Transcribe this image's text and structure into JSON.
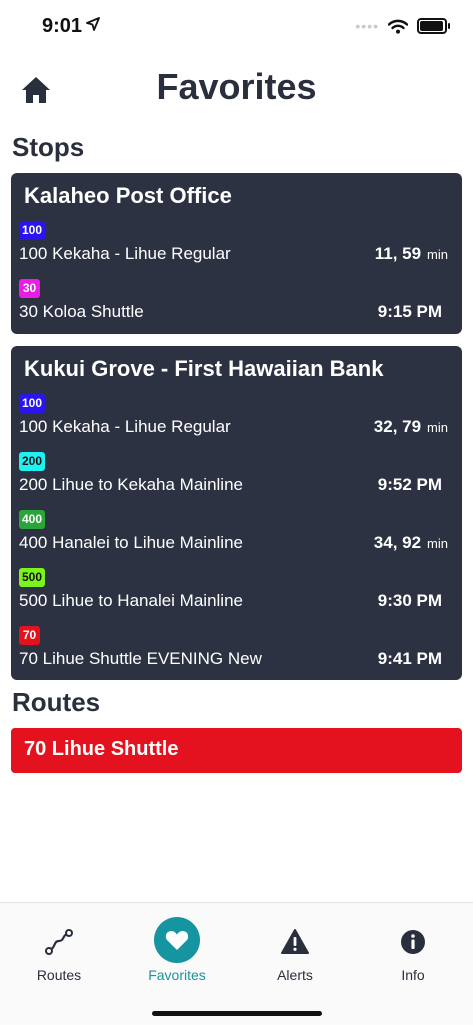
{
  "status_bar": {
    "time": "9:01",
    "icons": [
      "location-arrow-icon",
      "signal-dots-icon",
      "wifi-icon",
      "battery-icon"
    ]
  },
  "header": {
    "title": "Favorites",
    "home_icon": "home-icon"
  },
  "stops_heading": "Stops",
  "stops": [
    {
      "name": "Kalaheo Post Office",
      "routes": [
        {
          "badge": "100",
          "badge_color": "#2a14f0",
          "badge_text_color": "#ffffff",
          "name": "100 Kekaha - Lihue Regular",
          "time": "11, 59",
          "unit": "min"
        },
        {
          "badge": "30",
          "badge_color": "#e91de6",
          "badge_text_color": "#ffffff",
          "name": "30 Koloa Shuttle",
          "time": "9:15 PM",
          "unit": ""
        }
      ]
    },
    {
      "name": "Kukui Grove - First Hawaiian Bank",
      "routes": [
        {
          "badge": "100",
          "badge_color": "#2a14f0",
          "badge_text_color": "#ffffff",
          "name": "100 Kekaha - Lihue Regular",
          "time": "32, 79",
          "unit": "min"
        },
        {
          "badge": "200",
          "badge_color": "#1ff0f0",
          "badge_text_color": "#111111",
          "name": "200 Lihue to Kekaha Mainline",
          "time": "9:52 PM",
          "unit": ""
        },
        {
          "badge": "400",
          "badge_color": "#2aa53a",
          "badge_text_color": "#ffffff",
          "name": "400 Hanalei to Lihue Mainline",
          "time": "34, 92",
          "unit": "min"
        },
        {
          "badge": "500",
          "badge_color": "#7cf21e",
          "badge_text_color": "#111111",
          "name": "500 Lihue to Hanalei Mainline",
          "time": "9:30 PM",
          "unit": ""
        },
        {
          "badge": "70",
          "badge_color": "#e3121e",
          "badge_text_color": "#ffffff",
          "name": "70 Lihue Shuttle EVENING New",
          "time": "9:41 PM",
          "unit": ""
        }
      ]
    }
  ],
  "routes_heading": "Routes",
  "favorite_routes": [
    {
      "label": "70 Lihue Shuttle",
      "color": "#e3121e"
    }
  ],
  "tab_bar": {
    "active_color": "#16949f",
    "tabs": [
      {
        "label": "Routes",
        "icon": "route-path-icon",
        "active": false
      },
      {
        "label": "Favorites",
        "icon": "heart-icon",
        "active": true
      },
      {
        "label": "Alerts",
        "icon": "alert-triangle-icon",
        "active": false
      },
      {
        "label": "Info",
        "icon": "info-icon",
        "active": false
      }
    ]
  }
}
